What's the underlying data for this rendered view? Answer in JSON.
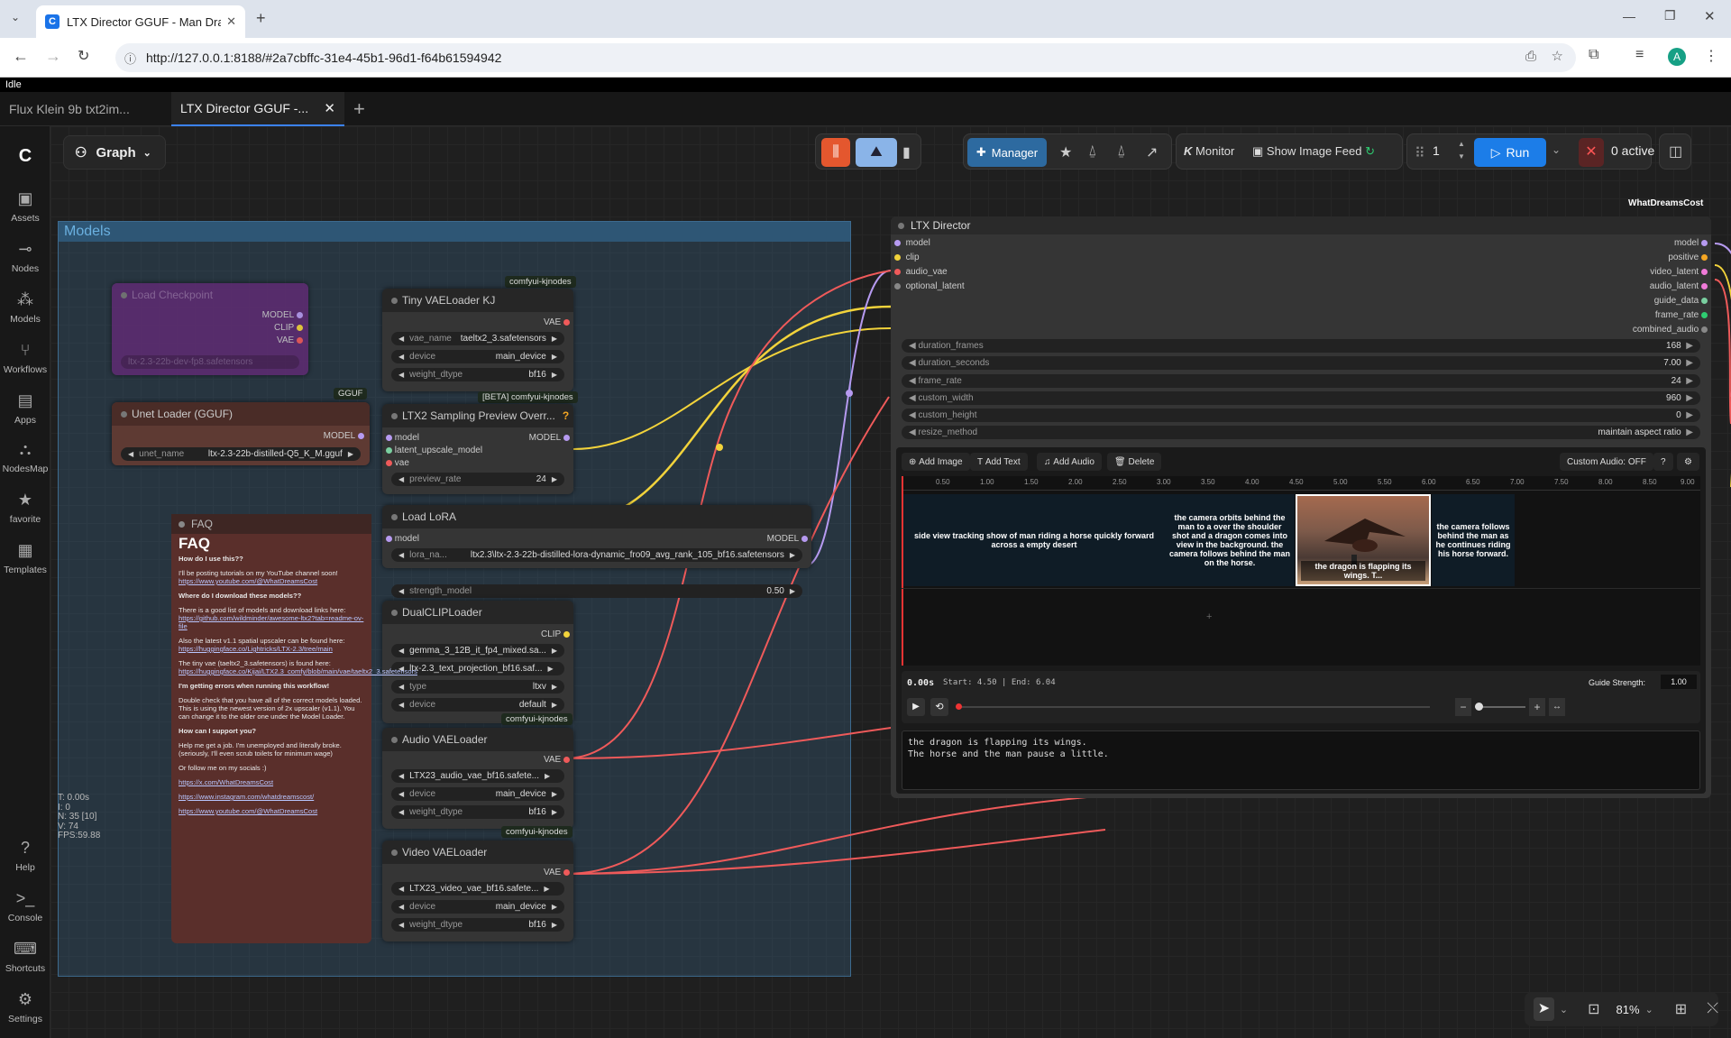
{
  "browser": {
    "tab_title": "LTX Director GGUF - Man Drag",
    "url": "http://127.0.0.1:8188/#2a7cbffc-31e4-45b1-96d1-f64b61594942",
    "avatar": "A"
  },
  "app": {
    "status": "Idle",
    "workflow_tabs": [
      "Flux Klein 9b txt2im...",
      "LTX Director GGUF -..."
    ],
    "graph_label": "Graph",
    "sidebar": [
      "Assets",
      "Nodes",
      "Models",
      "Workflows",
      "Apps",
      "NodesMap",
      "favorite",
      "Templates",
      "Help",
      "Console",
      "Shortcuts",
      "Settings"
    ],
    "toolbar": {
      "manager": "Manager",
      "monitor": "Monitor",
      "image_feed": "Show Image Feed",
      "queue_count": "1",
      "run": "Run",
      "active": "0 active"
    },
    "group_title": "Models",
    "brand_tag": "WhatDreamsCost",
    "zoom": "81%",
    "stats": [
      "T: 0.00s",
      "I: 0",
      "N: 35 [10]",
      "V: 74",
      "FPS:59.88"
    ]
  },
  "nodes": {
    "load_checkpoint": {
      "title": "Load Checkpoint",
      "outputs": [
        "MODEL",
        "CLIP",
        "VAE"
      ],
      "ckpt": "ltx-2.3-22b-dev-fp8.safetensors"
    },
    "unet_loader": {
      "title": "Unet Loader (GGUF)",
      "badge": "GGUF",
      "output": "MODEL",
      "name_label": "unet_name",
      "name": "ltx-2.3-22b-distilled-Q5_K_M.gguf"
    },
    "tiny_vae": {
      "title": "Tiny VAELoader KJ",
      "badge": "comfyui-kjnodes",
      "output": "VAE",
      "widgets": [
        [
          "vae_name",
          "taeltx2_3.safetensors"
        ],
        [
          "device",
          "main_device"
        ],
        [
          "weight_dtype",
          "bf16"
        ]
      ]
    },
    "ltx2_preview": {
      "title": "LTX2 Sampling Preview Overr...",
      "badge": "[BETA] comfyui-kjnodes",
      "inputs": [
        "model",
        "latent_upscale_model",
        "vae"
      ],
      "output": "MODEL",
      "widget": [
        "preview_rate",
        "24"
      ]
    },
    "load_lora": {
      "title": "Load LoRA",
      "input": "model",
      "output": "MODEL",
      "widgets": [
        [
          "lora_na...",
          "ltx2.3\\ltx-2.3-22b-distilled-lora-dynamic_fro09_avg_rank_105_bf16.safetensors"
        ],
        [
          "strength_model",
          "0.50"
        ]
      ]
    },
    "dual_clip": {
      "title": "DualCLIPLoader",
      "output": "CLIP",
      "widgets": [
        [
          "",
          "gemma_3_12B_it_fp4_mixed.sa..."
        ],
        [
          "",
          "ltx-2.3_text_projection_bf16.saf..."
        ],
        [
          "type",
          "ltxv"
        ],
        [
          "device",
          "default"
        ]
      ]
    },
    "audio_vae": {
      "title": "Audio VAELoader",
      "badge": "comfyui-kjnodes",
      "output": "VAE",
      "widgets": [
        [
          "",
          "LTX23_audio_vae_bf16.safete..."
        ],
        [
          "device",
          "main_device"
        ],
        [
          "weight_dtype",
          "bf16"
        ]
      ]
    },
    "video_vae": {
      "title": "Video VAELoader",
      "badge": "comfyui-kjnodes",
      "output": "VAE",
      "widgets": [
        [
          "",
          "LTX23_video_vae_bf16.safete..."
        ],
        [
          "device",
          "main_device"
        ],
        [
          "weight_dtype",
          "bf16"
        ]
      ]
    }
  },
  "faq": {
    "header": "FAQ",
    "title": "FAQ",
    "q1": "How do I use this??",
    "a1": "I'll be posting tutorials on my YouTube channel soon!",
    "l1": "https://www.youtube.com/@WhatDreamsCost",
    "q2": "Where do I download these models??",
    "a2": "There is a good list of models and download links here:",
    "l2": "https://github.com/wildminder/awesome-ltx2?tab=readme-ov-file",
    "a3": "Also the latest v1.1 spatial upscaler can be found here:",
    "l3": "https://huggingface.co/Lightricks/LTX-2.3/tree/main",
    "a4": "The tiny vae (taeltx2_3.safetensors) is found here:",
    "l4": "https://huggingface.co/Kijai/LTX2.3_comfy/blob/main/vae/taeltx2_3.safetensors",
    "q3": "I'm getting errors when running this workflow!",
    "a5": "Double check that you have all of the correct models loaded. This is using the newest version of 2x upscaler (v1.1). You can change it to the older one under the Model Loader.",
    "q4": "How can I support you?",
    "a6": "Help me get a job. I'm unemployed and literally broke. (seriously, I'll even scrub toilets for minimum wage)",
    "a7": "Or follow me on my socials :)",
    "l5": "https://x.com/WhatDreamsCost",
    "l6": "https://www.instagram.com/whatdreamscost/",
    "l7": "https://www.youtube.com/@WhatDreamsCost"
  },
  "director": {
    "title": "LTX Director",
    "inputs": [
      "model",
      "clip",
      "audio_vae",
      "optional_latent"
    ],
    "outputs": [
      "model",
      "positive",
      "video_latent",
      "audio_latent",
      "guide_data",
      "frame_rate",
      "combined_audio"
    ],
    "widgets": [
      [
        "duration_frames",
        "168"
      ],
      [
        "duration_seconds",
        "7.00"
      ],
      [
        "frame_rate",
        "24"
      ],
      [
        "custom_width",
        "960"
      ],
      [
        "custom_height",
        "0"
      ],
      [
        "resize_method",
        "maintain aspect ratio"
      ]
    ],
    "buttons": [
      "Add Image",
      "Add Text",
      "Add Audio",
      "Delete"
    ],
    "custom_audio": "Custom Audio: OFF",
    "ruler": [
      "0.50",
      "1.00",
      "1.50",
      "2.00",
      "2.50",
      "3.00",
      "3.50",
      "4.00",
      "4.50",
      "5.00",
      "5.50",
      "6.00",
      "6.50",
      "7.00",
      "7.50",
      "8.00",
      "8.50",
      "9.00"
    ],
    "clips": [
      "side view tracking show of man riding a horse quickly forward across a empty desert",
      "the camera orbits behind the man to a over the shoulder shot and a dragon comes into view in the background. the camera follows behind the man on the horse.",
      "the dragon is flapping its wings. T...",
      "the camera follows behind the man as he continues riding his horse forward."
    ],
    "time": "0.00s",
    "start_end": "Start: 4.50 | End: 6.04",
    "guide_label": "Guide Strength:",
    "guide_value": "1.00",
    "prompt": "the dragon is flapping its wings.\nThe horse and the man pause a little."
  },
  "colors": {
    "accent": "#2f7fd0",
    "run": "#1c7de8",
    "wire_vae": "#ef5a5a",
    "wire_clip": "#f2d33b",
    "wire_model": "#b69af0"
  }
}
